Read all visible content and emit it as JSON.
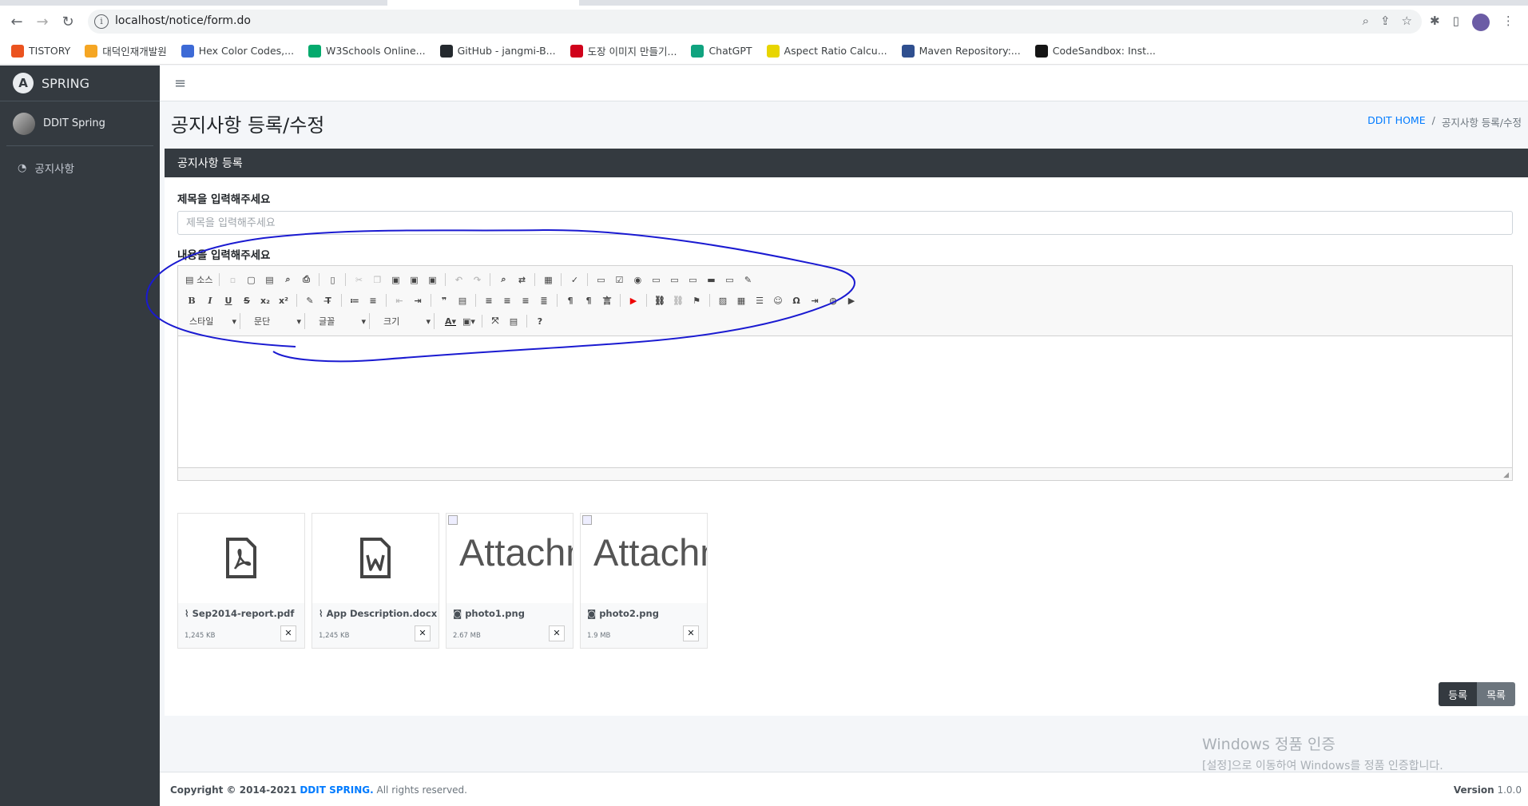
{
  "browser": {
    "url": "localhost/notice/form.do",
    "bookmarks": [
      {
        "label": "TISTORY",
        "color": "#eb531f"
      },
      {
        "label": "대덕인재개발원",
        "color": "#f5a623"
      },
      {
        "label": "Hex Color Codes,...",
        "color": "#3d6ad6"
      },
      {
        "label": "W3Schools Online...",
        "color": "#04aa6d"
      },
      {
        "label": "GitHub - jangmi-B...",
        "color": "#24292e"
      },
      {
        "label": "도장 이미지 만들기...",
        "color": "#d0021b"
      },
      {
        "label": "ChatGPT",
        "color": "#10a37f"
      },
      {
        "label": "Aspect Ratio Calcu...",
        "color": "#e8d500"
      },
      {
        "label": "Maven Repository:...",
        "color": "#2f4f8f"
      },
      {
        "label": "CodeSandbox: Inst...",
        "color": "#151515"
      }
    ]
  },
  "sidebar": {
    "brand": "SPRING",
    "brand_logo": "A",
    "user": "DDIT Spring",
    "items": [
      {
        "label": "공지사항",
        "icon": "tachometer-icon"
      }
    ]
  },
  "header": {
    "title": "공지사항 등록/수정",
    "breadcrumb_home": "DDIT HOME",
    "breadcrumb_sep": "/",
    "breadcrumb_current": "공지사항 등록/수정"
  },
  "card": {
    "title": "공지사항 등록",
    "title_label": "제목을 입력해주세요",
    "title_placeholder": "제목을 입력해주세요",
    "content_label": "내용을 입력해주세요"
  },
  "editor": {
    "source_label": "소스",
    "combos": [
      "스타일",
      "문단",
      "글꼴",
      "크기"
    ],
    "help": "?"
  },
  "attachments": [
    {
      "name": "Sep2014-report.pdf",
      "size": "1,245 KB",
      "type": "pdf",
      "kind_icon": "paperclip-icon"
    },
    {
      "name": "App Description.docx",
      "size": "1,245 KB",
      "type": "word",
      "kind_icon": "paperclip-icon"
    },
    {
      "name": "photo1.png",
      "size": "2.67 MB",
      "type": "image",
      "alt": "Attachment",
      "kind_icon": "camera-icon"
    },
    {
      "name": "photo2.png",
      "size": "1.9 MB",
      "type": "image",
      "alt": "Attachment",
      "kind_icon": "camera-icon"
    }
  ],
  "buttons": {
    "register": "등록",
    "list": "목록"
  },
  "watermark": {
    "line1": "Windows 정품 인증",
    "line2": "[설정]으로 이동하여 Windows를 정품 인증합니다."
  },
  "footer": {
    "copyright_prefix": "Copyright © 2014-2021",
    "brand": "DDIT SPRING.",
    "rights": "All rights reserved.",
    "version_label": "Version",
    "version": "1.0.0"
  }
}
